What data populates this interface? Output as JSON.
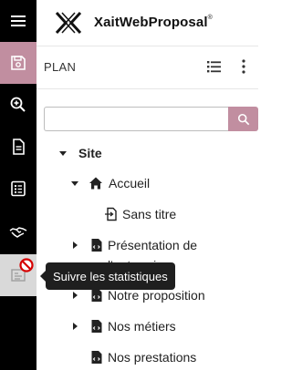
{
  "brand": {
    "name": "XaitWebProposal",
    "mark": "®"
  },
  "rail": {
    "items": [
      {
        "icon": "menu-icon"
      },
      {
        "icon": "save-icon",
        "state": "active"
      },
      {
        "icon": "zoom-in-icon"
      },
      {
        "icon": "document-icon"
      },
      {
        "icon": "checklist-icon"
      },
      {
        "icon": "handshake-icon"
      },
      {
        "icon": "statistics-icon",
        "state": "disabled"
      }
    ]
  },
  "plan": {
    "title": "PLAN"
  },
  "search": {
    "placeholder": "",
    "value": ""
  },
  "tree": [
    {
      "label": "Site",
      "level": 0,
      "expanded": true,
      "bold": true
    },
    {
      "label": "Accueil",
      "level": 1,
      "expanded": true,
      "icon": "home-icon"
    },
    {
      "label": "Sans titre",
      "level": 2,
      "icon": "page-link-icon"
    },
    {
      "label": "Présentation de l'entreprise",
      "level": 1,
      "expanded": false,
      "icon": "code-file-icon"
    },
    {
      "label": "Notre proposition",
      "level": 1,
      "expanded": false,
      "icon": "code-file-icon"
    },
    {
      "label": "Nos métiers",
      "level": 1,
      "expanded": false,
      "icon": "code-file-icon"
    },
    {
      "label": "Nos prestations",
      "level": 1,
      "icon": "code-file-icon"
    }
  ],
  "tooltip": {
    "text": "Suivre les statistiques"
  },
  "colors": {
    "accent": "#c18ea0",
    "rail": "#000000",
    "disabled": "#d9d9d9"
  }
}
